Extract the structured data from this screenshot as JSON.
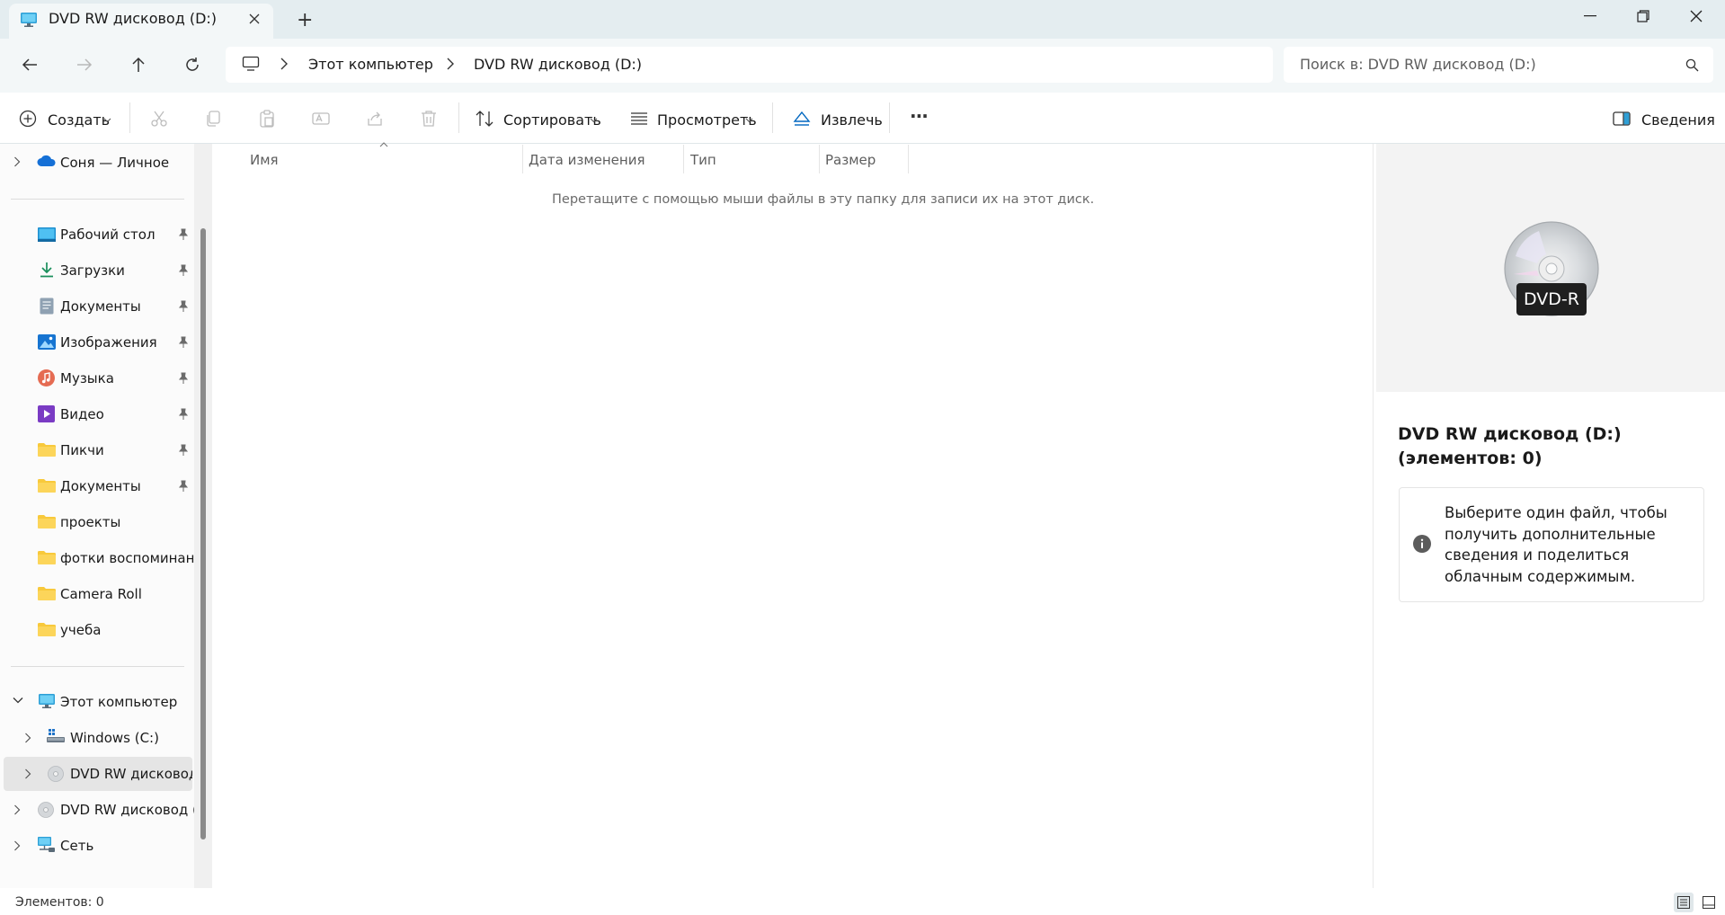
{
  "window": {
    "tab_title": "DVD RW дисковод (D:)",
    "new_tab": "+"
  },
  "address": {
    "crumbs": [
      "Этот компьютер",
      "DVD RW дисковод (D:)"
    ],
    "search_placeholder": "Поиск в: DVD RW дисковод (D:)"
  },
  "toolbar": {
    "new_label": "Создать",
    "sort_label": "Сортировать",
    "view_label": "Просмотреть",
    "eject_label": "Извлечь",
    "more_label": "···",
    "details_label": "Сведения"
  },
  "nav": {
    "onedrive": "Соня — Личное",
    "quick": [
      {
        "label": "Рабочий стол"
      },
      {
        "label": "Загрузки"
      },
      {
        "label": "Документы"
      },
      {
        "label": "Изображения"
      },
      {
        "label": "Музыка"
      },
      {
        "label": "Видео"
      },
      {
        "label": "Пикчи"
      },
      {
        "label": "Документы"
      },
      {
        "label": "проекты"
      },
      {
        "label": "фотки воспоминания"
      },
      {
        "label": "Camera Roll"
      },
      {
        "label": "учеба"
      }
    ],
    "this_pc": "Этот компьютер",
    "windows_c": "Windows (C:)",
    "dvd_sub": "DVD RW дисковод (D:)",
    "dvd_top": "DVD RW дисковод (D:)",
    "network": "Сеть"
  },
  "content": {
    "columns": [
      "Имя",
      "Дата изменения",
      "Тип",
      "Размер"
    ],
    "empty_message": "Перетащите с помощью мыши файлы в эту папку для записи их на этот диск."
  },
  "details": {
    "disc_label": "DVD-R",
    "title": "DVD RW дисковод (D:) (элементов: 0)",
    "info": "Выберите один файл, чтобы получить дополнительные сведения и поделиться облачным содержимым."
  },
  "status": {
    "items": "Элементов: 0"
  },
  "colors": {
    "accent": "#0067c0",
    "titlebar": "#e4edf0",
    "selected_nav": "#e5e5e5",
    "folder": "#f8c93b"
  }
}
